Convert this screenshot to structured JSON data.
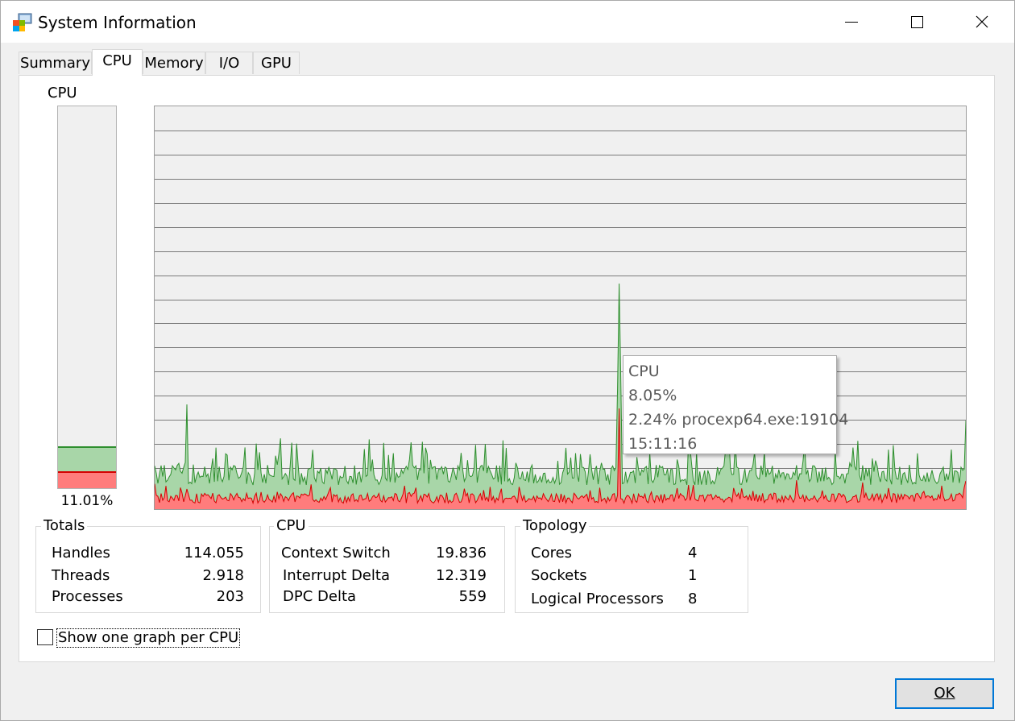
{
  "window": {
    "title": "System Information"
  },
  "colors": {
    "green_fill": "#a8d6a8",
    "green_line": "#2f8f2f",
    "red_fill": "#ff7c7c",
    "red_line": "#d40000",
    "accent": "#0078d7"
  },
  "tabs": [
    {
      "label": "Summary",
      "active": false
    },
    {
      "label": "CPU",
      "active": true
    },
    {
      "label": "Memory",
      "active": false
    },
    {
      "label": "I/O",
      "active": false
    },
    {
      "label": "GPU",
      "active": false
    }
  ],
  "meter": {
    "label": "CPU",
    "percent_text": "11.01%",
    "total_fraction": 0.1101,
    "kernel_fraction": 0.045
  },
  "graph": {
    "seed": 7
  },
  "tooltip": {
    "line1": "CPU",
    "line2": "8.05%",
    "line3": "2.24% procexp64.exe:19104",
    "line4": "15:11:16"
  },
  "totals": {
    "title": "Totals",
    "rows": [
      {
        "label": "Handles",
        "value": "114.055"
      },
      {
        "label": "Threads",
        "value": "2.918"
      },
      {
        "label": "Processes",
        "value": "203"
      }
    ]
  },
  "cpu_stats": {
    "title": "CPU",
    "rows": [
      {
        "label": "Context Switch",
        "value": "19.836"
      },
      {
        "label": "Interrupt Delta",
        "value": "12.319"
      },
      {
        "label": "DPC Delta",
        "value": "559"
      }
    ]
  },
  "topology": {
    "title": "Topology",
    "rows": [
      {
        "label": "Cores",
        "value": "4"
      },
      {
        "label": "Sockets",
        "value": "1"
      },
      {
        "label": "Logical Processors",
        "value": "8"
      }
    ]
  },
  "options": {
    "per_cpu_label": "Show one graph per CPU",
    "per_cpu_checked": false
  },
  "footer": {
    "ok_label": "OK"
  }
}
